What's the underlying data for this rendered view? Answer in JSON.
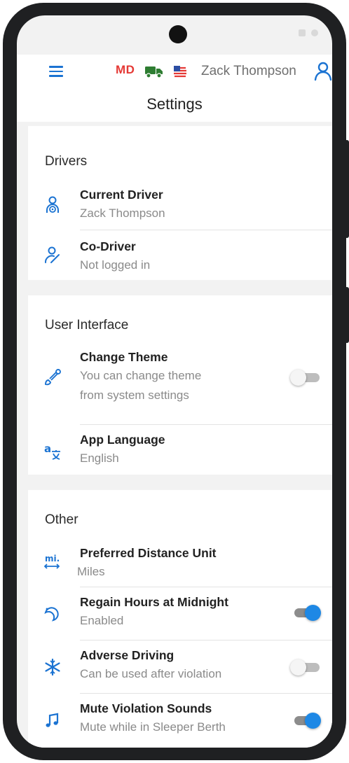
{
  "topbar": {
    "state": "MD",
    "username": "Zack Thompson"
  },
  "header": {
    "title": "Settings"
  },
  "sections": {
    "drivers": {
      "title": "Drivers",
      "current_driver": {
        "title": "Current Driver",
        "subtitle": "Zack Thompson"
      },
      "co_driver": {
        "title": "Co-Driver",
        "subtitle": "Not logged in"
      }
    },
    "user_interface": {
      "title": "User Interface",
      "change_theme": {
        "title": "Change Theme",
        "subtitle_line1": "You can change theme",
        "subtitle_line2": "from system settings",
        "enabled": false
      },
      "app_language": {
        "title": "App Language",
        "subtitle": "English"
      }
    },
    "other": {
      "title": "Other",
      "distance_unit": {
        "title": "Preferred Distance Unit",
        "subtitle": "Miles",
        "icon_text": "mi."
      },
      "regain_hours": {
        "title": "Regain Hours at Midnight",
        "subtitle": "Enabled",
        "enabled": true
      },
      "adverse_driving": {
        "title": "Adverse Driving",
        "subtitle": "Can be used after violation",
        "enabled": false
      },
      "mute_violation": {
        "title": "Mute Violation Sounds",
        "subtitle": "Mute while in Sleeper Berth",
        "enabled": true
      }
    }
  },
  "colors": {
    "accent": "#1e88e5",
    "icon_blue": "#1b73d2",
    "state_red": "#e53935",
    "truck_green": "#2e7d32"
  },
  "icons": [
    "menu-icon",
    "truck-icon",
    "us-flag-icon",
    "user-icon",
    "driver-icon",
    "co-driver-icon",
    "brush-icon",
    "translate-icon",
    "distance-icon",
    "moon-clock-icon",
    "snowflake-icon",
    "music-note-icon"
  ]
}
